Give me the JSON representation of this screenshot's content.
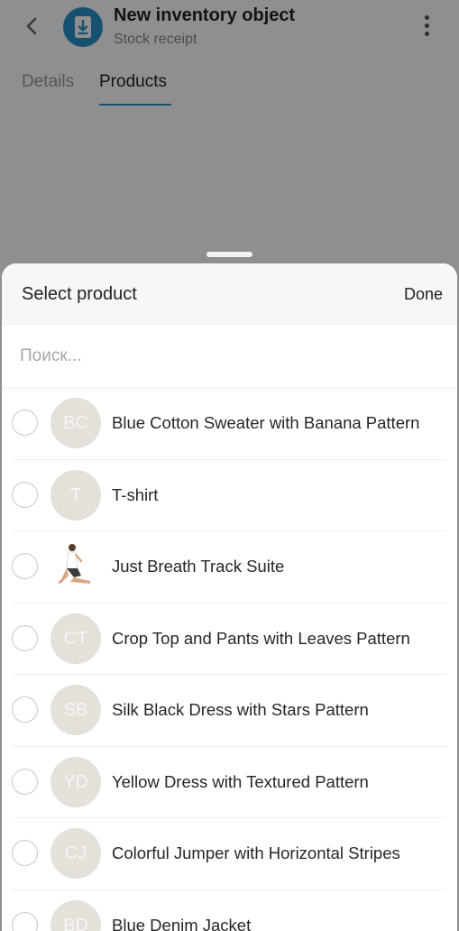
{
  "app": {
    "title": "New inventory object",
    "subtitle": "Stock receipt",
    "tabs": [
      {
        "label": "Details"
      },
      {
        "label": "Products"
      }
    ]
  },
  "sheet": {
    "title": "Select product",
    "done_label": "Done",
    "search_placeholder": "Поиск...",
    "products": [
      {
        "initials": "BC",
        "name": "Blue Cotton Sweater with Banana Pattern"
      },
      {
        "initials": "T",
        "name": "T-shirt"
      },
      {
        "initials": "",
        "name": "Just Breath Track Suite"
      },
      {
        "initials": "CT",
        "name": "Crop Top and Pants with Leaves Pattern"
      },
      {
        "initials": "SB",
        "name": "Silk Black Dress with Stars Pattern"
      },
      {
        "initials": "YD",
        "name": "Yellow Dress with Textured Pattern"
      },
      {
        "initials": "CJ",
        "name": "Colorful Jumper with Horizontal Stripes"
      },
      {
        "initials": "BD",
        "name": "Blue Denim Jacket"
      }
    ]
  },
  "colors": {
    "accent": "#2a8fc9",
    "scrim": "#8f8f8f",
    "avatar_bg": "#e4e0da"
  }
}
